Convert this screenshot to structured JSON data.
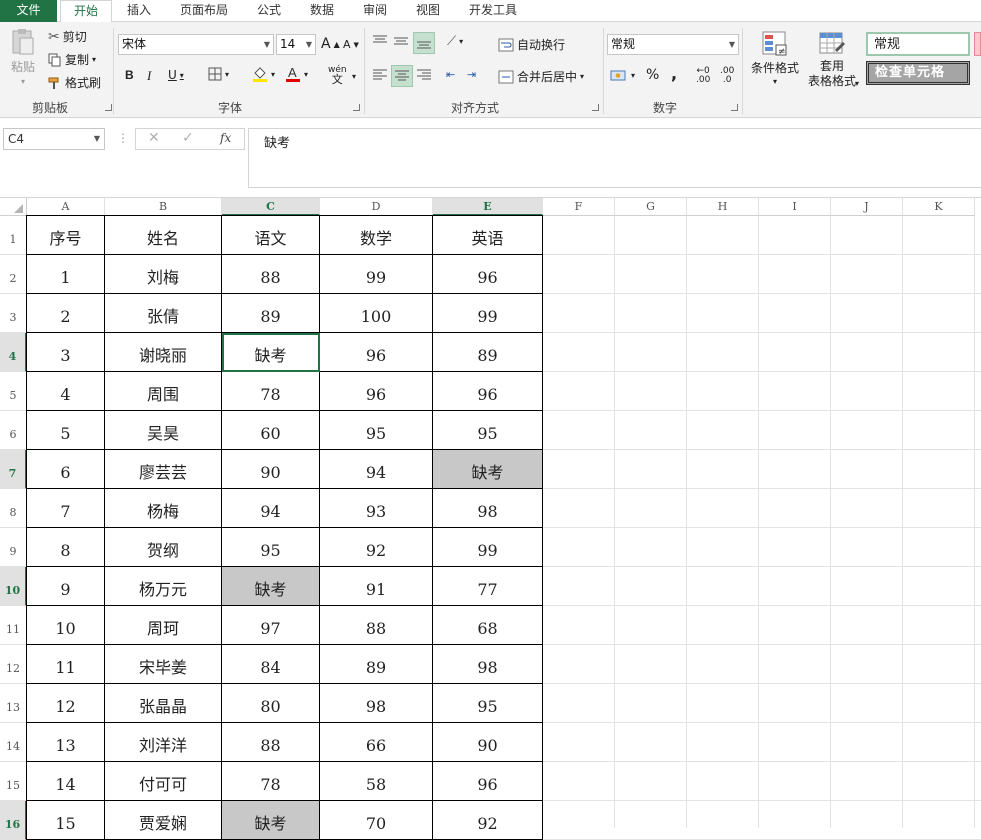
{
  "tabs": [
    {
      "id": "file",
      "label": "文件"
    },
    {
      "id": "home",
      "label": "开始"
    },
    {
      "id": "insert",
      "label": "插入"
    },
    {
      "id": "layout",
      "label": "页面布局"
    },
    {
      "id": "formulas",
      "label": "公式"
    },
    {
      "id": "data",
      "label": "数据"
    },
    {
      "id": "review",
      "label": "审阅"
    },
    {
      "id": "view",
      "label": "视图"
    },
    {
      "id": "developer",
      "label": "开发工具"
    }
  ],
  "ribbon": {
    "clipboard": {
      "paste": "粘贴",
      "cut": "剪切",
      "copy": "复制",
      "format_painter": "格式刷",
      "group": "剪贴板"
    },
    "font": {
      "name": "宋体",
      "size": "14",
      "bold": "B",
      "italic": "I",
      "underline": "U",
      "grow": "A",
      "shrink": "A",
      "phonetic": "wén",
      "group": "字体"
    },
    "alignment": {
      "wrap": "自动换行",
      "merge": "合并后居中",
      "group": "对齐方式"
    },
    "number": {
      "format": "常规",
      "percent": "%",
      "comma": ",",
      "inc_decimal": ".00",
      "dec_decimal": ".0",
      "group": "数字"
    },
    "styles": {
      "conditional": "条件格式",
      "table_format_1": "套用",
      "table_format_2": "表格格式",
      "normal": "常规",
      "check_cell": "检查单元格"
    }
  },
  "formula_bar": {
    "name_box": "C4",
    "fx": "fx",
    "content": "缺考"
  },
  "columns": [
    "A",
    "B",
    "C",
    "D",
    "E",
    "F",
    "G",
    "H",
    "I",
    "J",
    "K"
  ],
  "rows": [
    "1",
    "2",
    "3",
    "4",
    "5",
    "6",
    "7",
    "8",
    "9",
    "10",
    "11",
    "12",
    "13",
    "14",
    "15",
    "16"
  ],
  "table": {
    "headers": [
      "序号",
      "姓名",
      "语文",
      "数学",
      "英语"
    ],
    "data": [
      [
        "1",
        "刘梅",
        "88",
        "99",
        "96"
      ],
      [
        "2",
        "张倩",
        "89",
        "100",
        "99"
      ],
      [
        "3",
        "谢晓丽",
        "缺考",
        "96",
        "89"
      ],
      [
        "4",
        "周围",
        "78",
        "96",
        "96"
      ],
      [
        "5",
        "吴昊",
        "60",
        "95",
        "95"
      ],
      [
        "6",
        "廖芸芸",
        "90",
        "94",
        "缺考"
      ],
      [
        "7",
        "杨梅",
        "94",
        "93",
        "98"
      ],
      [
        "8",
        "贺纲",
        "95",
        "92",
        "99"
      ],
      [
        "9",
        "杨万元",
        "缺考",
        "91",
        "77"
      ],
      [
        "10",
        "周珂",
        "97",
        "88",
        "68"
      ],
      [
        "11",
        "宋毕姜",
        "84",
        "89",
        "98"
      ],
      [
        "12",
        "张晶晶",
        "80",
        "98",
        "95"
      ],
      [
        "13",
        "刘洋洋",
        "88",
        "66",
        "90"
      ],
      [
        "14",
        "付可可",
        "78",
        "58",
        "96"
      ],
      [
        "15",
        "贾爱娴",
        "缺考",
        "70",
        "92"
      ]
    ]
  },
  "colors": {
    "accent": "#217346",
    "highlight": "#c8c8c8"
  }
}
